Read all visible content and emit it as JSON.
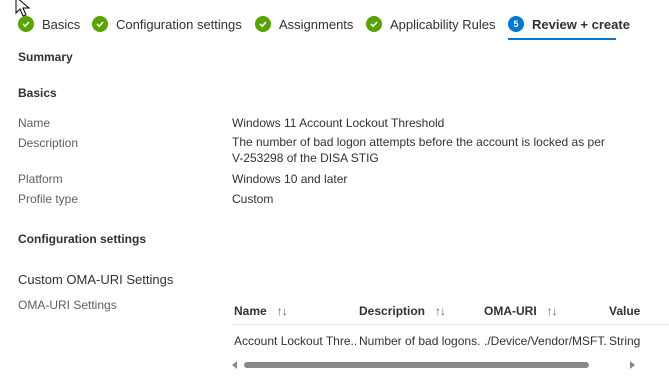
{
  "wizard": {
    "steps": [
      {
        "label": "Basics",
        "state": "complete"
      },
      {
        "label": "Configuration settings",
        "state": "complete"
      },
      {
        "label": "Assignments",
        "state": "complete"
      },
      {
        "label": "Applicability Rules",
        "state": "complete"
      },
      {
        "label": "Review + create",
        "state": "active",
        "number": "5"
      }
    ]
  },
  "summary": {
    "title": "Summary",
    "basics_heading": "Basics",
    "name_label": "Name",
    "name_value": "Windows 11 Account Lockout Threshold",
    "description_label": "Description",
    "description_value": "The number of bad logon attempts before the account is locked as per V-253298 of the DISA STIG",
    "platform_label": "Platform",
    "platform_value": "Windows 10 and later",
    "profile_type_label": "Profile type",
    "profile_type_value": "Custom",
    "config_heading": "Configuration settings",
    "custom_oma_heading": "Custom OMA-URI Settings",
    "oma_settings_label": "OMA-URI Settings"
  },
  "table": {
    "columns": [
      "Name",
      "Description",
      "OMA-URI",
      "Value"
    ],
    "sort_glyph": "↑↓",
    "rows": [
      [
        "Account Lockout Thre...",
        "Number of bad logons...",
        "./Device/Vendor/MSFT...",
        "String"
      ]
    ]
  },
  "colors": {
    "complete": "#57a300",
    "active": "#0078d4"
  }
}
